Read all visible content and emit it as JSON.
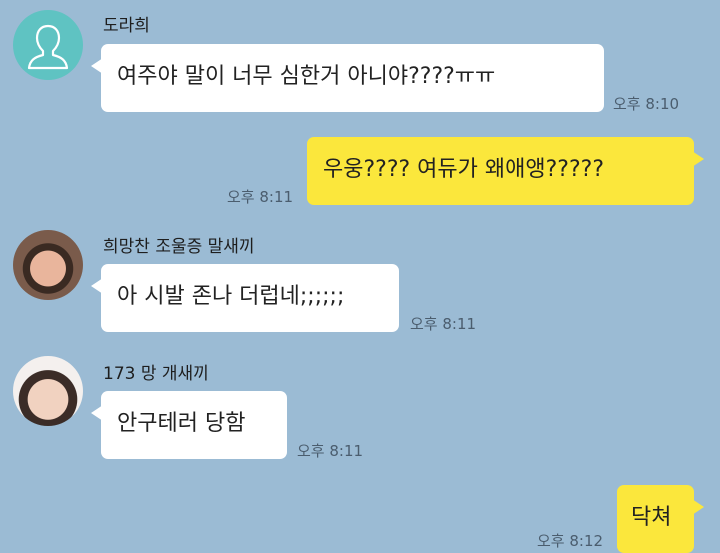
{
  "theme": {
    "background": "#9bbbd4",
    "outgoing_bubble": "#fbe73c",
    "incoming_bubble": "#ffffff",
    "default_avatar": "#5fc3c2"
  },
  "messages": [
    {
      "direction": "incoming",
      "sender": "도라희",
      "text": "여주야 말이 너무 심한거 아니야????ㅠㅠ",
      "time": "오후 8:10",
      "avatar": "default-person-icon"
    },
    {
      "direction": "outgoing",
      "text": "우웅???? 여듀가 왜애앵?????",
      "time": "오후 8:11"
    },
    {
      "direction": "incoming",
      "sender": "희망찬 조울증 말새끼",
      "text": "아 시발 존나 더럽네;;;;;;",
      "time": "오후 8:11",
      "avatar": "profile-photo"
    },
    {
      "direction": "incoming",
      "sender": "173 망 개새끼",
      "text": "안구테러 당함",
      "time": "오후 8:11",
      "avatar": "profile-photo"
    },
    {
      "direction": "outgoing",
      "text": "닥쳐",
      "time": "오후 8:12"
    }
  ]
}
